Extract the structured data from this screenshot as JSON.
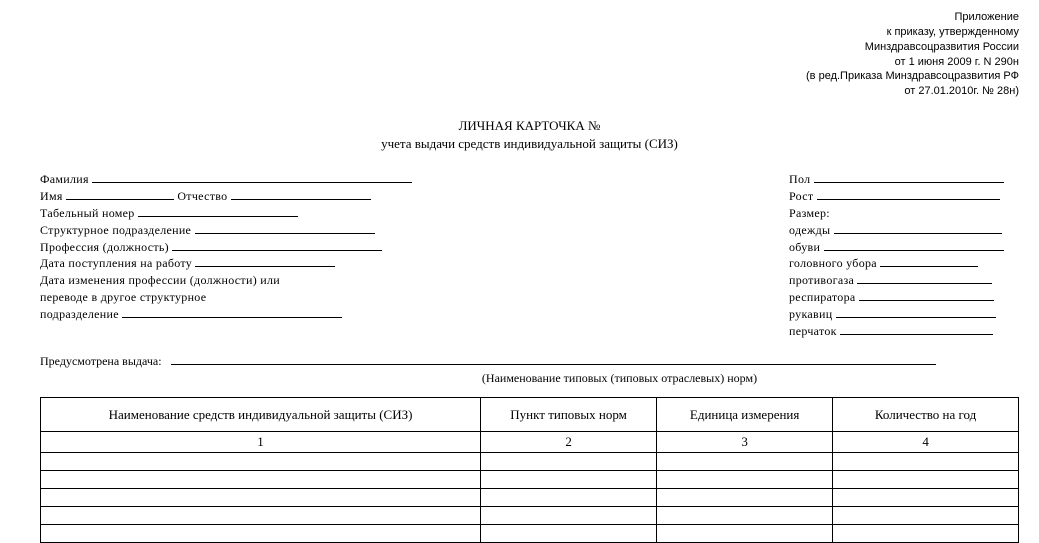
{
  "header": {
    "l1": "Приложение",
    "l2": "к приказу, утвержденному",
    "l3": "Минздравсоцразвития России",
    "l4": "от 1 июня 2009 г. N 290н",
    "l5": "(в ред.Приказа Минздравсоцразвития РФ",
    "l6": "от 27.01.2010г. № 28н)"
  },
  "title": {
    "line1": "ЛИЧНАЯ КАРТОЧКА №",
    "line2": "учета выдачи средств индивидуальной защиты (СИЗ)"
  },
  "left": {
    "surname": "Фамилия",
    "name": "Имя",
    "patronymic": "Отчество",
    "tab_no": "Табельный номер",
    "dept": "Структурное подразделение",
    "profession": "Профессия (должность)",
    "hire_date": "Дата поступления на работу",
    "change_l1": "Дата изменения профессии (должности) или",
    "change_l2": "переводе в другое структурное",
    "change_l3": "подразделение"
  },
  "right": {
    "sex": "Пол",
    "height": "Рост",
    "size": "Размер:",
    "clothes": "одежды",
    "shoes": "обуви",
    "headwear": "головного убора",
    "gasmask": "противогаза",
    "respirator": "респиратора",
    "gloves_r": "рукавиц",
    "gloves_p": "перчаток"
  },
  "provide": {
    "label": "Предусмотрена выдача:",
    "caption": "(Наименование типовых (типовых отраслевых) норм)"
  },
  "table": {
    "h1": "Наименование средств индивидуальной защиты (СИЗ)",
    "h2": "Пункт типовых норм",
    "h3": "Единица измерения",
    "h4": "Количество на год",
    "n1": "1",
    "n2": "2",
    "n3": "3",
    "n4": "4"
  }
}
